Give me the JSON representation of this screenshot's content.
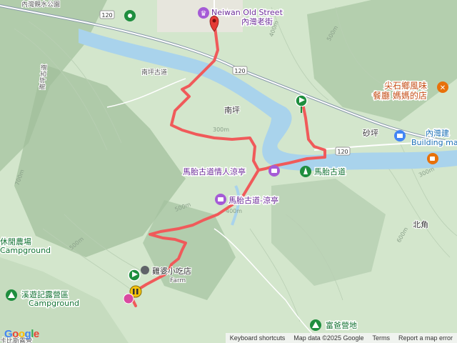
{
  "colors": {
    "route": "#f05a5a",
    "river": "#a9d3ec",
    "road": "#ffffff",
    "poi_purple": "#a55bd6",
    "poi_green": "#1e8e3e",
    "poi_orange": "#e8710a",
    "poi_blue": "#4285f4"
  },
  "labels": {
    "neiwan_old_street": "Neiwan Old Street",
    "neiwan_old_street_zh": "內灣老街",
    "water_park": "內灣親水公園",
    "nanping_road": "南坪古道",
    "nanping": "南坪",
    "matai_love": "馬胎古道情人涼亭",
    "matai_trail": "馬胎古道",
    "matai_pavilion": "馬胎古道-涼亭",
    "farm_shop": "雞婆小吃店",
    "farm_sub": "Farm",
    "leisure_farm": "休閒農場",
    "campground_sub": "Campground",
    "camp_xiyou": "溪遊記露營區",
    "fugu_camp": "富爸營地",
    "restaurant_line1": "尖石鄉風味",
    "restaurant_line2": "餐廳 媽媽的店",
    "shaping": "砂坪",
    "neiwan_building": "內灣建",
    "building_material": "Building mat",
    "beijiao": "北角",
    "bottom_left": "卡比斯露營"
  },
  "roads": {
    "r120": "120"
  },
  "contours": [
    "300m",
    "400m",
    "500m",
    "600m",
    "700m"
  ],
  "google_logo": [
    "G",
    "o",
    "o",
    "g",
    "l",
    "e"
  ],
  "attribution": {
    "keyboard": "Keyboard shortcuts",
    "map_data": "Map data ©2025 Google",
    "terms": "Terms",
    "report": "Report a map error"
  }
}
